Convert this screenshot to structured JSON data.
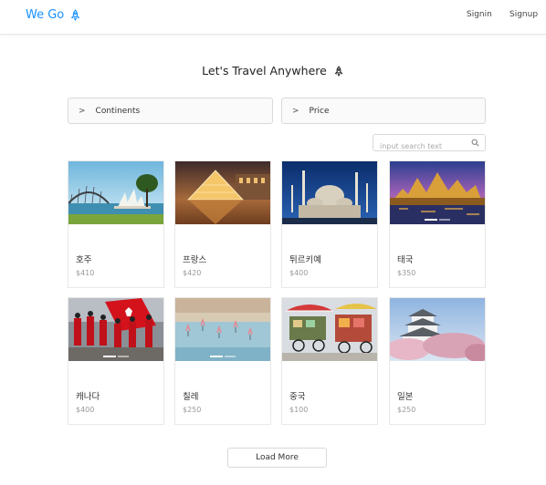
{
  "header": {
    "brand": "We Go",
    "brand_icon": "rocket-icon",
    "signin": "Signin",
    "signup": "Signup",
    "accent_color": "#1890ff"
  },
  "main": {
    "title": "Let's Travel Anywhere",
    "title_icon": "rocket-icon",
    "filters": [
      {
        "label": "Continents",
        "icon": "chevron-right-icon"
      },
      {
        "label": "Price",
        "icon": "chevron-right-icon"
      }
    ],
    "search": {
      "placeholder": "input search text",
      "value": "",
      "icon": "search-icon"
    },
    "cards": [
      {
        "name": "호주",
        "price": "$410"
      },
      {
        "name": "프랑스",
        "price": "$420"
      },
      {
        "name": "튀르키예",
        "price": "$400"
      },
      {
        "name": "태국",
        "price": "$350"
      },
      {
        "name": "캐나다",
        "price": "$400"
      },
      {
        "name": "칠레",
        "price": "$250"
      },
      {
        "name": "중국",
        "price": "$100"
      },
      {
        "name": "일본",
        "price": "$250"
      }
    ],
    "load_more": "Load More"
  }
}
